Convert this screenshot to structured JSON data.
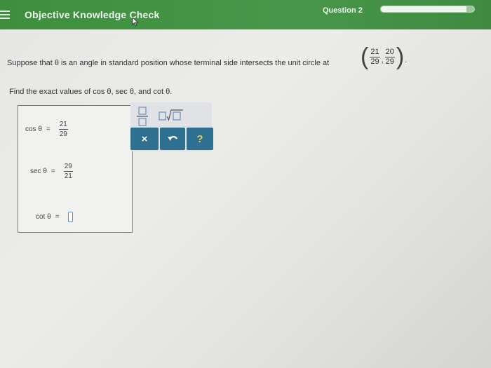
{
  "header": {
    "title": "Objective Knowledge Check",
    "question_label": "Question 2",
    "progress": 0.92
  },
  "question": {
    "text": "Suppose that θ is an angle in standard position whose terminal side intersects the unit circle at",
    "point": {
      "x_num": "21",
      "x_den": "29",
      "y_num": "20",
      "y_den": "29"
    }
  },
  "instruction": "Find the exact values of cos θ, sec θ, and cot θ.",
  "answers": [
    {
      "label": "cos θ",
      "eq": "=",
      "num": "21",
      "den": "29"
    },
    {
      "label": "sec θ",
      "eq": "=",
      "num": "29",
      "den": "21"
    },
    {
      "label": "cot θ",
      "eq": "="
    }
  ],
  "toolbar": {
    "fraction_icon": "fraction-icon",
    "sqrt_icon": "sqrt-icon",
    "clear_label": "×",
    "undo_icon": "undo-icon",
    "help_label": "?"
  },
  "colors": {
    "header_green": "#46924a",
    "button_blue": "#2f6f8f",
    "help_yellow": "#f3c85a"
  }
}
